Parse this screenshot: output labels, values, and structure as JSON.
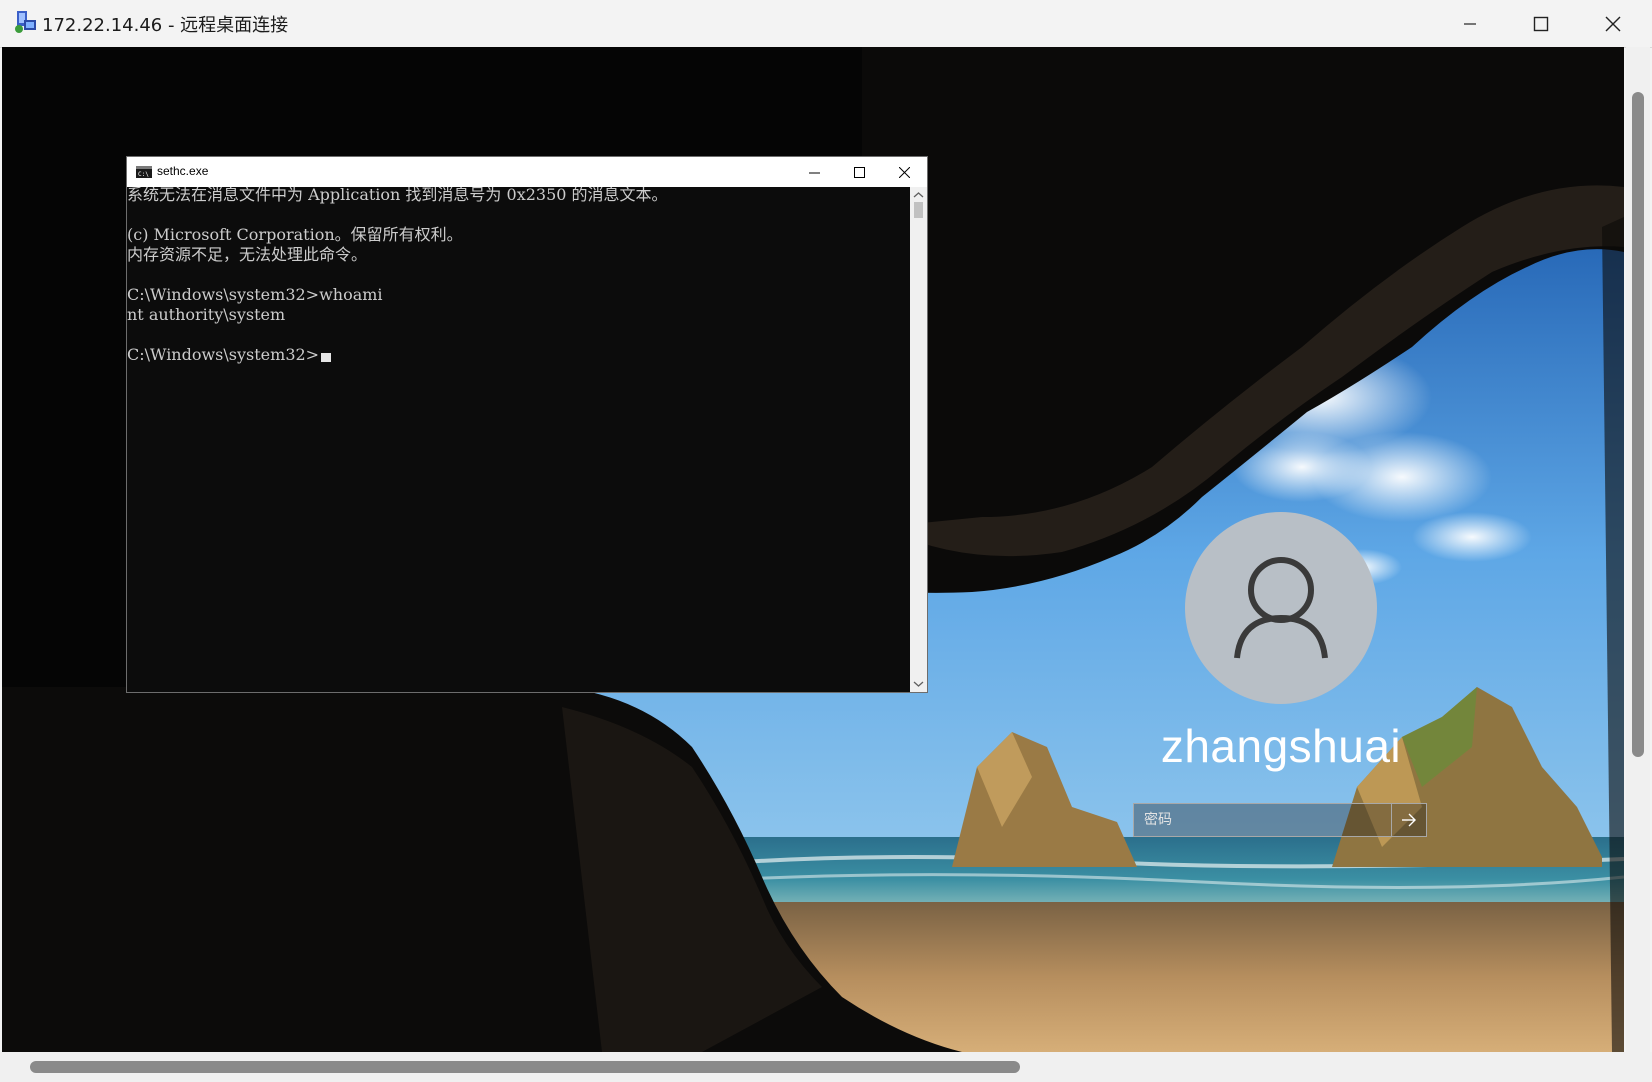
{
  "window": {
    "title": "172.22.14.46 - 远程桌面连接",
    "icon": "remote-desktop-icon"
  },
  "window_controls": {
    "minimize": "minimize-icon",
    "maximize": "maximize-icon",
    "close": "close-icon"
  },
  "cmd": {
    "title": "sethc.exe",
    "icon": "console-icon",
    "lines": [
      "系统无法在消息文件中为 Application 找到消息号为 0x2350 的消息文本。",
      "",
      "(c) Microsoft Corporation。保留所有权利。",
      "内存资源不足，无法处理此命令。",
      "",
      "C:\\Windows\\system32>whoami",
      "nt authority\\system",
      ""
    ],
    "prompt": "C:\\Windows\\system32>"
  },
  "lockscreen": {
    "avatar_icon": "user-avatar-icon",
    "username": "zhangshuai",
    "password_placeholder": "密码",
    "submit_icon": "arrow-right-icon"
  },
  "colors": {
    "cmd_background": "#0c0c0c",
    "cmd_text": "#cccccc",
    "titlebar": "#f3f3f3",
    "avatar": "#b8bfc6"
  }
}
